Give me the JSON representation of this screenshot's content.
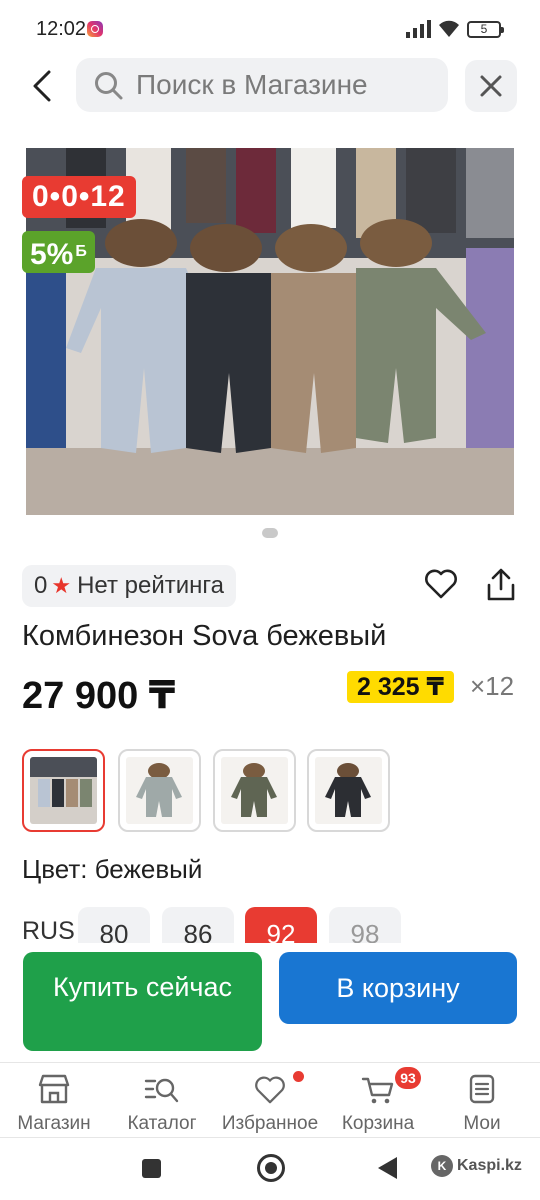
{
  "status_bar": {
    "time": "12:02",
    "battery": "5"
  },
  "search": {
    "placeholder": "Поиск в Магазине"
  },
  "product": {
    "badge_installment": "0•0•12",
    "badge_bonus": "5%",
    "badge_bonus_currency": "Б",
    "rating_value": "0",
    "rating_text": "Нет рейтинга",
    "title": "Комбинезон Sova бежевый",
    "price": "27 900 ₸",
    "monthly_payment": "2 325 ₸",
    "installment_multiplier": "×12",
    "color_label": "Цвет: бежевый"
  },
  "colors": [
    {
      "name": "beige",
      "selected": true
    },
    {
      "name": "grey-blue",
      "selected": false
    },
    {
      "name": "olive",
      "selected": false
    },
    {
      "name": "black",
      "selected": false
    }
  ],
  "sizes": {
    "system": "RUS",
    "options": [
      {
        "label": "80",
        "state": "normal"
      },
      {
        "label": "86",
        "state": "normal"
      },
      {
        "label": "92",
        "state": "active"
      },
      {
        "label": "98",
        "state": "disabled"
      }
    ]
  },
  "actions": {
    "buy_now": "Купить сейчас",
    "add_to_cart": "В корзину"
  },
  "tabbar": {
    "items": [
      {
        "label": "Магазин",
        "icon": "shop-icon"
      },
      {
        "label": "Каталог",
        "icon": "catalog-search-icon"
      },
      {
        "label": "Избранное",
        "icon": "heart-icon"
      },
      {
        "label": "Корзина",
        "icon": "cart-icon"
      },
      {
        "label": "Мои",
        "icon": "orders-icon"
      }
    ],
    "cart_count": "93"
  },
  "watermark": "Kaspi.kz",
  "colors_theme": {
    "accent_red": "#e83b32",
    "buy_green": "#1fa04a",
    "cart_blue": "#1976d2",
    "monthly_yellow": "#ffdb00"
  }
}
